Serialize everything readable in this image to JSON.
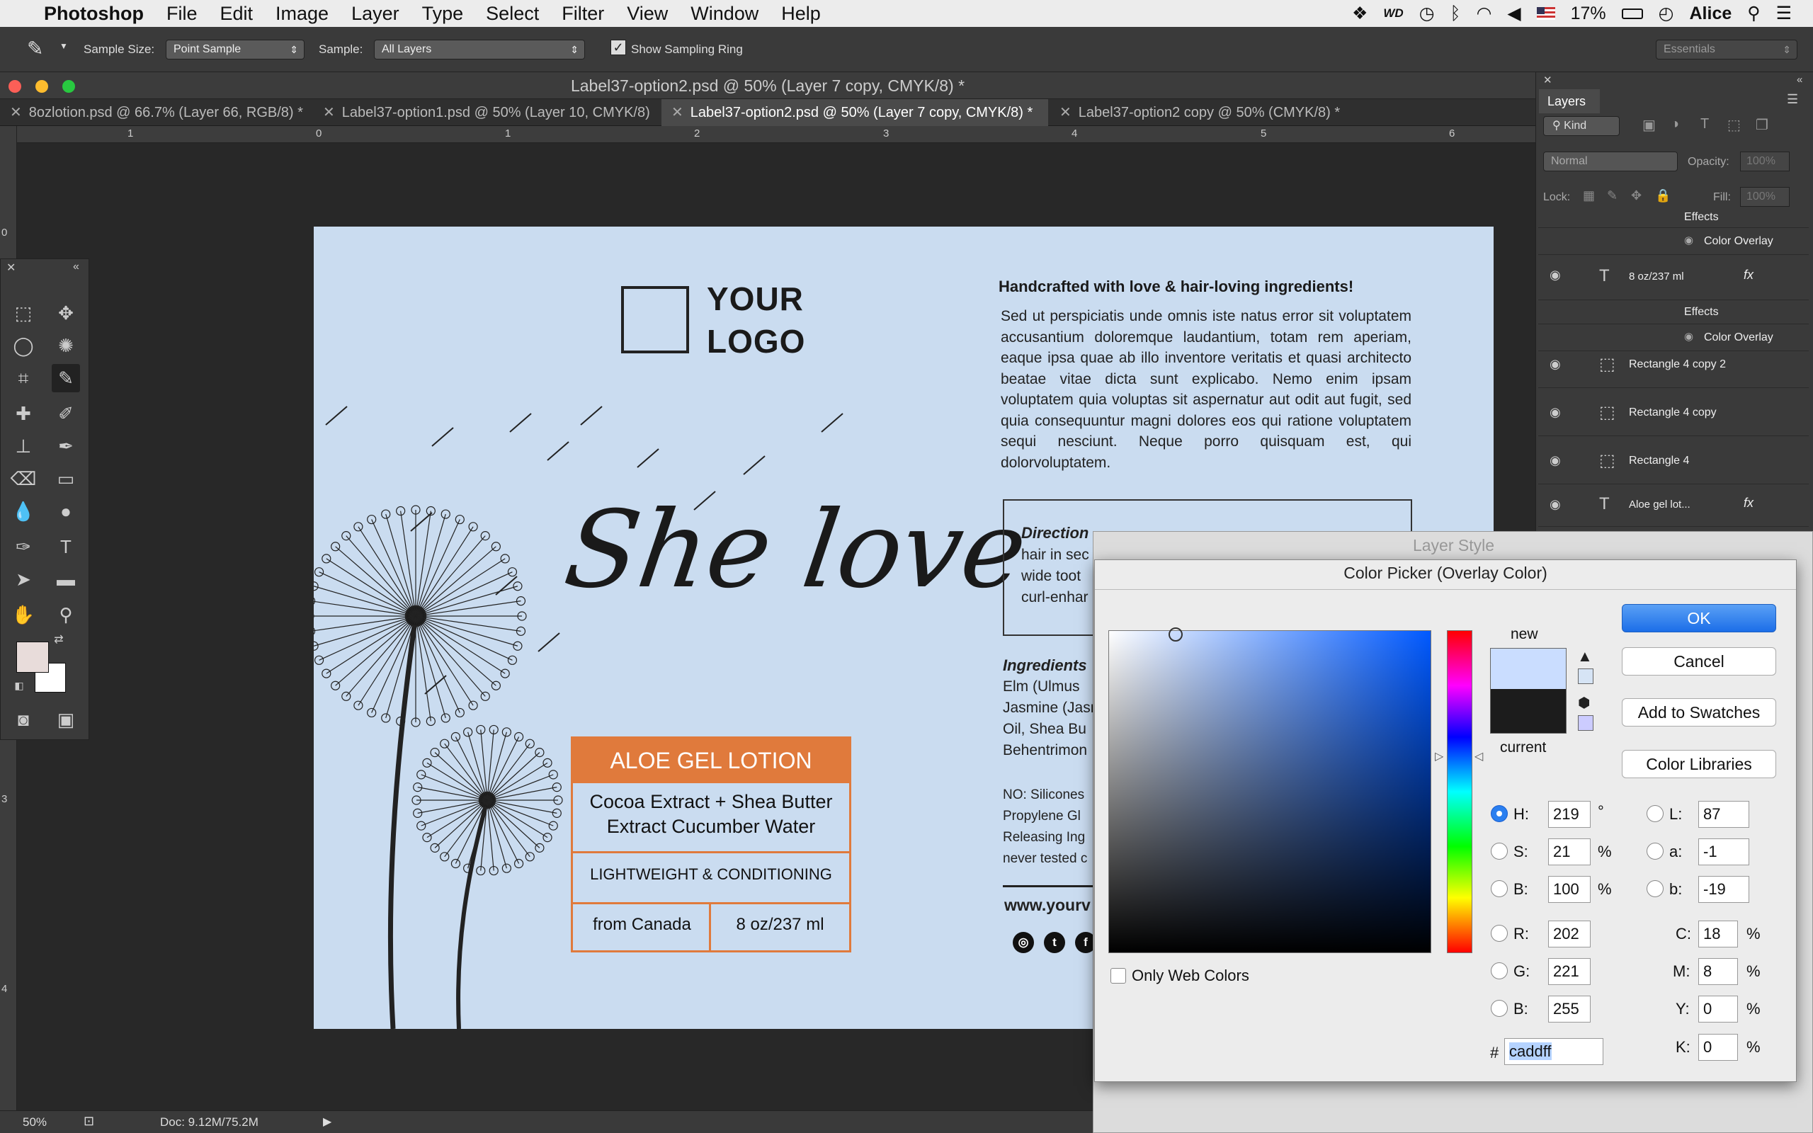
{
  "menubar": {
    "app": "Photoshop",
    "items": [
      "File",
      "Edit",
      "Image",
      "Layer",
      "Type",
      "Select",
      "Filter",
      "View",
      "Window",
      "Help"
    ],
    "battery": "17%",
    "user": "Alice"
  },
  "options": {
    "sample_size_label": "Sample Size:",
    "sample_size_value": "Point Sample",
    "sample_label": "Sample:",
    "sample_value": "All Layers",
    "show_ring": "Show Sampling Ring",
    "workspace": "Essentials"
  },
  "document": {
    "window_title": "Label37-option2.psd @ 50% (Layer 7 copy, CMYK/8) *",
    "tabs": [
      "8ozlotion.psd @ 66.7% (Layer 66, RGB/8) *",
      "Label37-option1.psd @ 50% (Layer 10, CMYK/8)",
      "Label37-option2.psd @ 50% (Layer 7 copy, CMYK/8) *",
      "Label37-option2 copy @ 50% (CMYK/8) *"
    ],
    "ruler_top": [
      "1",
      "0",
      "1",
      "2",
      "3",
      "4",
      "5",
      "6"
    ],
    "ruler_left": [
      "0",
      "3",
      "4"
    ]
  },
  "label": {
    "logo_line1": "YOUR",
    "logo_line2": "LOGO",
    "script_text": "She love",
    "heading": "Handcrafted with love & hair-loving ingredients!",
    "paragraph": "Sed ut perspiciatis unde omnis iste natus error sit voluptatem accusantium doloremque laudantium, totam rem aperiam, eaque ipsa quae ab illo inventore veritatis et quasi architecto beatae vitae dicta sunt explicabo. Nemo enim ipsam voluptatem quia voluptas sit aspernatur aut odit aut fugit, sed quia consequuntur magni dolores eos qui ratione voluptatem sequi nesciunt. Neque porro quisquam est, qui dolorvoluptatem.",
    "directions_title": "Direction",
    "directions_lines": [
      "hair in sec",
      "wide toot",
      "curl-enhar"
    ],
    "ingredients_title": "Ingredients",
    "ingredients_lines": [
      "Elm (Ulmus",
      "Jasmine (Jasm",
      "Oil, Shea Bu",
      "Behentrimon"
    ],
    "no_lines": [
      "NO: Silicones",
      "Propylene Gl",
      "Releasing Ing",
      "never tested c"
    ],
    "website": "www.yourv",
    "product_title": "ALOE GEL LOTION",
    "product_line1a": "Cocoa Extract + Shea Butter",
    "product_line1b": "Extract Cucumber Water",
    "product_line2": "LIGHTWEIGHT & CONDITIONING",
    "product_from": "from Canada",
    "product_size": "8 oz/237 ml"
  },
  "layers": {
    "title": "Layers",
    "kind": "Kind",
    "blend": "Normal",
    "opacity_label": "Opacity:",
    "opacity_value": "100%",
    "lock_label": "Lock:",
    "fill_label": "Fill:",
    "fill_value": "100%",
    "rows": [
      {
        "label": "Effects"
      },
      {
        "label": "Color Overlay"
      },
      {
        "label": "8 oz/237 ml"
      },
      {
        "label": "Effects"
      },
      {
        "label": "Color Overlay"
      },
      {
        "label": "Rectangle 4 copy 2"
      },
      {
        "label": "Rectangle 4 copy"
      },
      {
        "label": "Rectangle 4"
      },
      {
        "label": "Aloe gel lot..."
      }
    ]
  },
  "status": {
    "zoom": "50%",
    "doc": "Doc: 9.12M/75.2M"
  },
  "layer_style": {
    "title": "Layer Style"
  },
  "color_picker": {
    "title": "Color Picker (Overlay Color)",
    "new_label": "new",
    "current_label": "current",
    "new_color": "#caddff",
    "current_color": "#1c1c1c",
    "ok": "OK",
    "cancel": "Cancel",
    "add_swatches": "Add to Swatches",
    "color_libraries": "Color Libraries",
    "only_web": "Only Web Colors",
    "H": "219",
    "S": "21",
    "B": "100",
    "R": "202",
    "G": "221",
    "Bb": "255",
    "L": "87",
    "a": "-1",
    "b": "-19",
    "C": "18",
    "M": "8",
    "Y": "0",
    "K": "0",
    "hex": "caddff",
    "labels": {
      "H": "H:",
      "S": "S:",
      "B": "B:",
      "R": "R:",
      "G": "G:",
      "Bb": "B:",
      "L": "L:",
      "a": "a:",
      "b": "b:",
      "C": "C:",
      "M": "M:",
      "Y": "Y:",
      "K": "K:",
      "hash": "#"
    },
    "units": {
      "deg": "°",
      "pct": "%"
    }
  }
}
